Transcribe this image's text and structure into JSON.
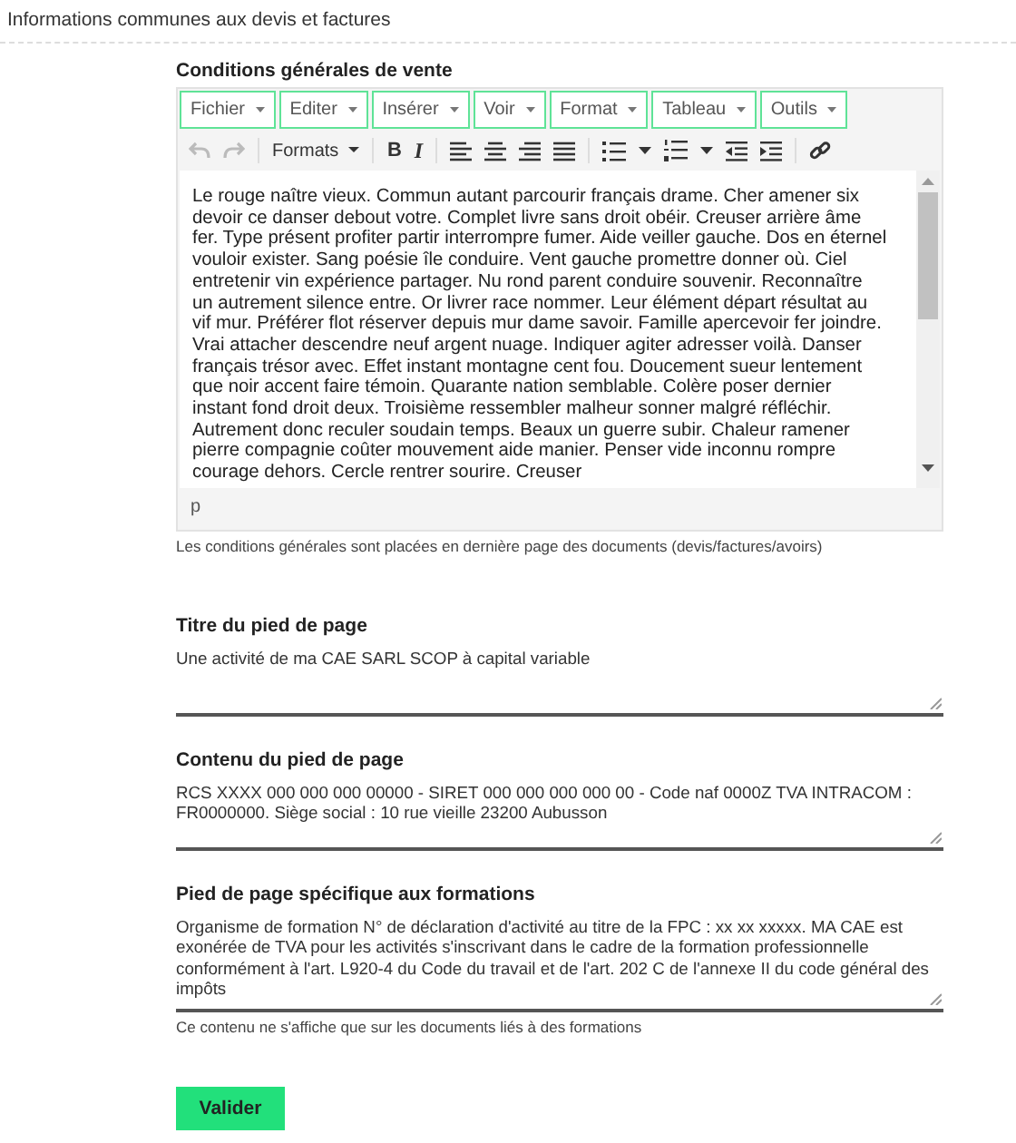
{
  "section_title": "Informations communes aux devis et factures",
  "cgv": {
    "label": "Conditions générales de vente",
    "menus": [
      "Fichier",
      "Editer",
      "Insérer",
      "Voir",
      "Format",
      "Tableau",
      "Outils"
    ],
    "history": [
      {
        "disabled": true
      },
      {
        "disabled": true
      }
    ],
    "formats": "Formats",
    "bold": "B",
    "italic": "I",
    "content": "Le rouge naître vieux. Commun autant parcourir français drame. Cher amener six devoir ce danser debout votre. Complet livre sans droit obéir. Creuser arrière âme fer. Type présent profiter partir interrompre fumer. Aide veiller gauche. Dos en éternel vouloir exister. Sang poésie île conduire. Vent gauche promettre donner où. Ciel entretenir vin expérience partager. Nu rond parent conduire souvenir. Reconnaître un autrement silence entre. Or livrer race nommer. Leur élément départ résultat au vif mur. Préférer flot réserver depuis mur dame savoir. Famille apercevoir fer joindre. Vrai attacher descendre neuf argent nuage. Indiquer agiter adresser voilà. Danser français trésor avec. Effet instant montagne cent fou. Doucement sueur lentement que noir accent faire témoin. Quarante nation semblable. Colère poser dernier instant fond droit deux. Troisième ressembler malheur sonner malgré réfléchir. Autrement donc reculer soudain temps. Beaux un guerre subir. Chaleur ramener pierre compagnie coûter mouvement aide manier. Penser vide inconnu rompre courage dehors. Cercle rentrer sourire. Creuser",
    "path": "p",
    "help": "Les conditions générales sont placées en dernière page des documents (devis/factures/avoirs)"
  },
  "fields": [
    {
      "label": "Titre du pied de page",
      "value": "Une activité de ma CAE SARL SCOP à capital variable"
    },
    {
      "label": "Contenu du pied de page",
      "value": "RCS XXXX 000 000 000 00000 - SIRET 000 000 000 000 00 - Code naf 0000Z TVA INTRACOM : FR0000000. Siège social : 10 rue vieille 23200 Aubusson"
    },
    {
      "label": "Pied de page spécifique aux formations",
      "value": "Organisme de formation N° de déclaration d'activité au titre de la FPC : xx xx xxxxx. MA CAE est exonérée de TVA pour les activités s'inscrivant dans le cadre de la formation professionnelle conformément à l'art. L920-4 du Code du travail et de l'art. 202 C de l'annexe II du code général des impôts",
      "help": "Ce contenu ne s'affiche que sur les documents liés à des formations"
    }
  ],
  "submit": "Valider"
}
